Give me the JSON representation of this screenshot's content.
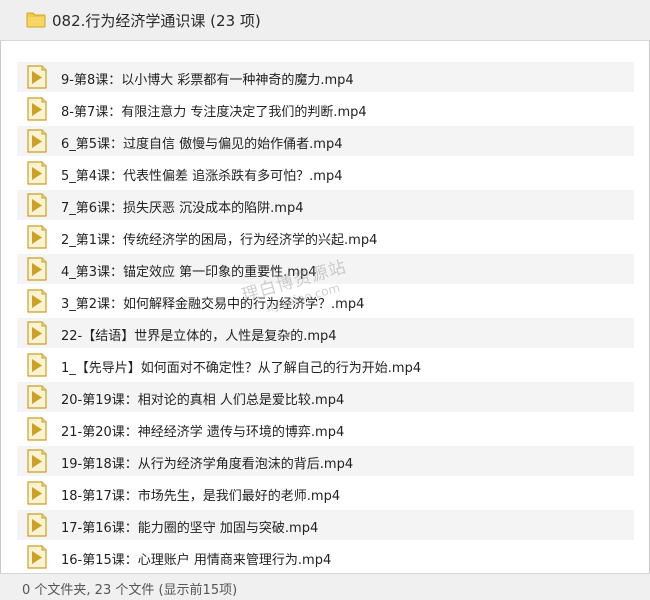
{
  "window": {
    "title": "082.行为经济学通识课 (23 项)",
    "folder_icon": "folder-icon"
  },
  "files": [
    {
      "name": "9-第8课：以小博大   彩票都有一种神奇的魔力.mp4",
      "icon": "media-play-icon"
    },
    {
      "name": "8-第7课：有限注意力   专注度决定了我们的判断.mp4",
      "icon": "media-play-icon"
    },
    {
      "name": "6_第5课：过度自信   傲慢与偏见的始作俑者.mp4",
      "icon": "media-play-icon"
    },
    {
      "name": "5_第4课：代表性偏差   追涨杀跌有多可怕？.mp4",
      "icon": "media-play-icon"
    },
    {
      "name": "7_第6课：损失厌恶   沉没成本的陷阱.mp4",
      "icon": "media-play-icon"
    },
    {
      "name": "2_第1课：传统经济学的困局，行为经济学的兴起.mp4",
      "icon": "media-play-icon"
    },
    {
      "name": "4_第3课：锚定效应   第一印象的重要性.mp4",
      "icon": "media-play-icon"
    },
    {
      "name": "3_第2课：如何解释金融交易中的行为经济学？.mp4",
      "icon": "media-play-icon"
    },
    {
      "name": "22-【结语】世界是立体的，人性是复杂的.mp4",
      "icon": "media-play-icon"
    },
    {
      "name": "1_【先导片】如何面对不确定性？从了解自己的行为开始.mp4",
      "icon": "media-play-icon"
    },
    {
      "name": "20-第19课：相对论的真相   人们总是爱比较.mp4",
      "icon": "media-play-icon"
    },
    {
      "name": "21-第20课：神经经济学   遗传与环境的博弈.mp4",
      "icon": "media-play-icon"
    },
    {
      "name": "19-第18课：从行为经济学角度看泡沫的背后.mp4",
      "icon": "media-play-icon"
    },
    {
      "name": "18-第17课：市场先生，是我们最好的老师.mp4",
      "icon": "media-play-icon"
    },
    {
      "name": "17-第16课：能力圈的坚守   加固与突破.mp4",
      "icon": "media-play-icon"
    },
    {
      "name": "16-第15课：心理账户   用情商来管理行为.mp4",
      "icon": "media-play-icon"
    }
  ],
  "footer": {
    "status": "0 个文件夹, 23 个文件 (显示前15项)"
  },
  "watermark": {
    "text_cn": "理白博资源站",
    "text_en": "liyepiao.com"
  },
  "colors": {
    "header_bg": "#efefef",
    "row_alt_bg": "#f4f4f4",
    "icon_gold": "#c8a02a",
    "folder_yellow": "#f2c94c"
  }
}
